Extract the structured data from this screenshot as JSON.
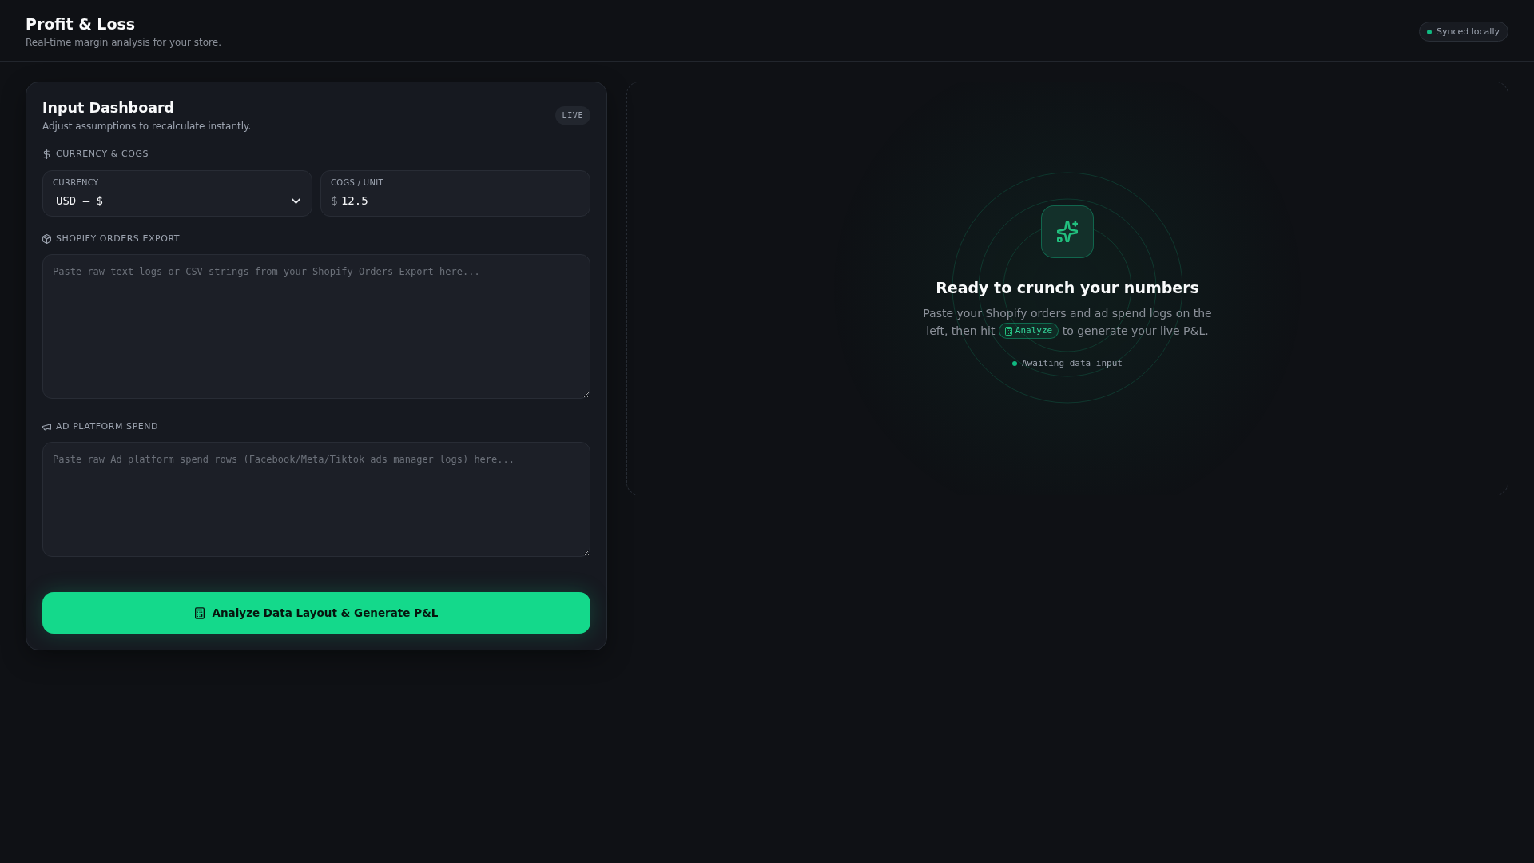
{
  "header": {
    "title": "Profit & Loss",
    "subtitle": "Real-time margin analysis for your store.",
    "status": {
      "label": "Synced locally",
      "color": "#10b981"
    }
  },
  "input_panel": {
    "title": "Input Dashboard",
    "subtitle": "Adjust assumptions to recalculate instantly.",
    "badge": "LIVE",
    "sections": [
      {
        "kind": "fields",
        "heading": "CURRENCY & COGS",
        "fields": [
          {
            "kind": "select",
            "label": "CURRENCY",
            "value": "USD — $"
          },
          {
            "kind": "number",
            "label": "COGS / UNIT",
            "prefix": "$",
            "value": "12.5"
          }
        ]
      },
      {
        "kind": "textarea",
        "heading": "SHOPIFY ORDERS EXPORT",
        "placeholder": "Paste raw text logs or CSV strings from your Shopify Orders Export here..."
      },
      {
        "kind": "textarea",
        "heading": "AD PLATFORM SPEND",
        "placeholder": "Paste raw Ad platform spend rows (Facebook/Meta/Tiktok ads manager logs) here..."
      }
    ],
    "button": "Analyze Data Layout & Generate P&L"
  },
  "empty_state": {
    "title": "Ready to crunch your numbers",
    "text_before": "Paste your Shopify orders and ad spend logs on the left, then hit",
    "chip": "Analyze",
    "text_after": "to generate your live P&L.",
    "status": {
      "label": "Awaiting data input",
      "color": "#10b981"
    }
  }
}
